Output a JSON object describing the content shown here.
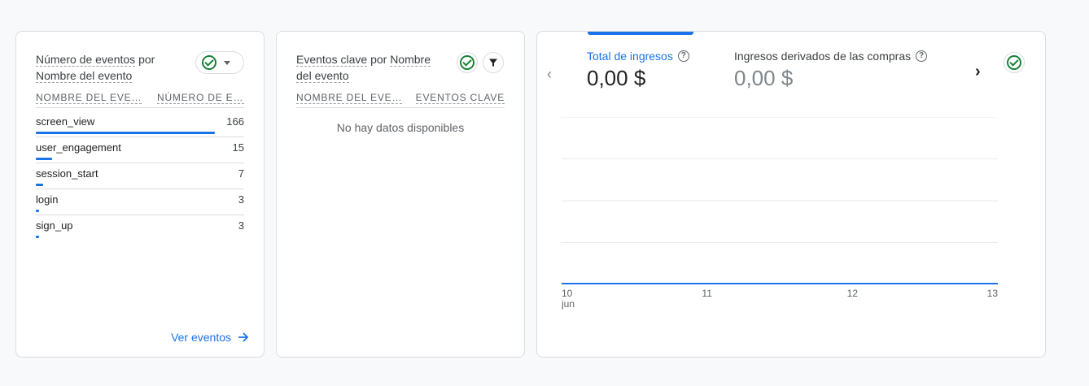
{
  "card_events": {
    "title_part1": "Número de eventos",
    "title_part2": "por",
    "title_part3": "Nombre del evento",
    "col_name": "NOMBRE DEL EVENTO",
    "col_value": "NÚMERO DE EVENTOS",
    "rows": [
      {
        "name": "screen_view",
        "value": "166",
        "count": 166
      },
      {
        "name": "user_engagement",
        "value": "15",
        "count": 15
      },
      {
        "name": "session_start",
        "value": "7",
        "count": 7
      },
      {
        "name": "login",
        "value": "3",
        "count": 3
      },
      {
        "name": "sign_up",
        "value": "3",
        "count": 3
      }
    ],
    "link_label": "Ver eventos"
  },
  "card_key_events": {
    "title_part1": "Eventos clave",
    "title_part2": "por",
    "title_part3": "Nombre del evento",
    "col_name": "NOMBRE DEL EVENTO",
    "col_value": "EVENTOS CLAVE",
    "empty_message": "No hay datos disponibles"
  },
  "card_revenue": {
    "metric1_label": "Total de ingresos",
    "metric1_value": "0,00 $",
    "metric2_label": "Ingresos derivados de las compras",
    "metric2_value": "0,00 $",
    "help_symbol": "?",
    "prev_symbol": "‹",
    "next_symbol": "›"
  },
  "chart_data": {
    "type": "line",
    "x": [
      "10",
      "11",
      "12",
      "13"
    ],
    "x_sublabel": "jun",
    "series": [
      {
        "values": [
          0,
          0,
          0,
          0
        ]
      }
    ],
    "grid": true
  },
  "colors": {
    "accent": "#1a73e8",
    "success": "#188038",
    "border": "#dadce0"
  }
}
